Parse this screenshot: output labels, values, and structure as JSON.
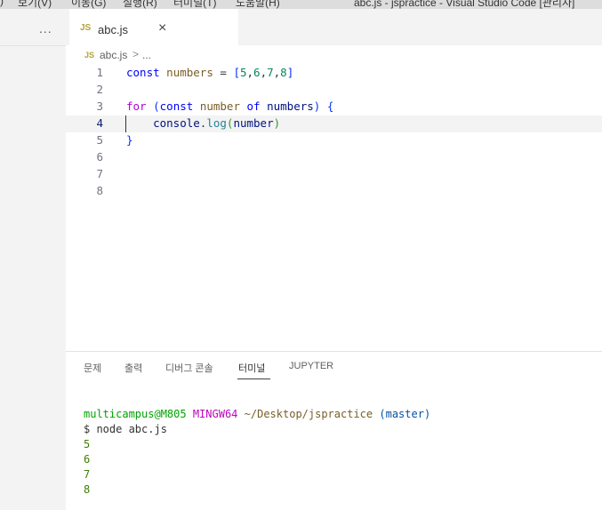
{
  "menubar": {
    "items": [
      "보기(V)",
      "이동(G)",
      "실행(R)",
      "터미널(T)",
      "도움말(H)"
    ],
    "window_title": "abc.js - jspractice - Visual Studio Code [관리자]"
  },
  "sidebar": {
    "more_icon": "..."
  },
  "tab": {
    "badge": "JS",
    "label": "abc.js",
    "close": "×"
  },
  "breadcrumb": {
    "badge": "JS",
    "file": "abc.js",
    "sep": ">",
    "more": "..."
  },
  "editor": {
    "line_numbers": [
      "1",
      "2",
      "3",
      "4",
      "5",
      "6",
      "7",
      "8"
    ],
    "active_line": 4
  },
  "panel": {
    "tabs": [
      "문제",
      "출력",
      "디버그 콘솔",
      "터미널",
      "JUPYTER"
    ],
    "active_tab": "터미널"
  },
  "terminal": {
    "user": "multicampus@M805",
    "host": "MINGW64",
    "path": "~/Desktop/jspractice",
    "branch": "(master)",
    "command": "$ node abc.js",
    "output": [
      "5",
      "6",
      "7",
      "8"
    ]
  },
  "colors": {
    "keyword": "#0000ff",
    "control": "#af00db",
    "number": "#098658",
    "function": "#795e26",
    "active_line_bg": "#f3f3f3"
  }
}
